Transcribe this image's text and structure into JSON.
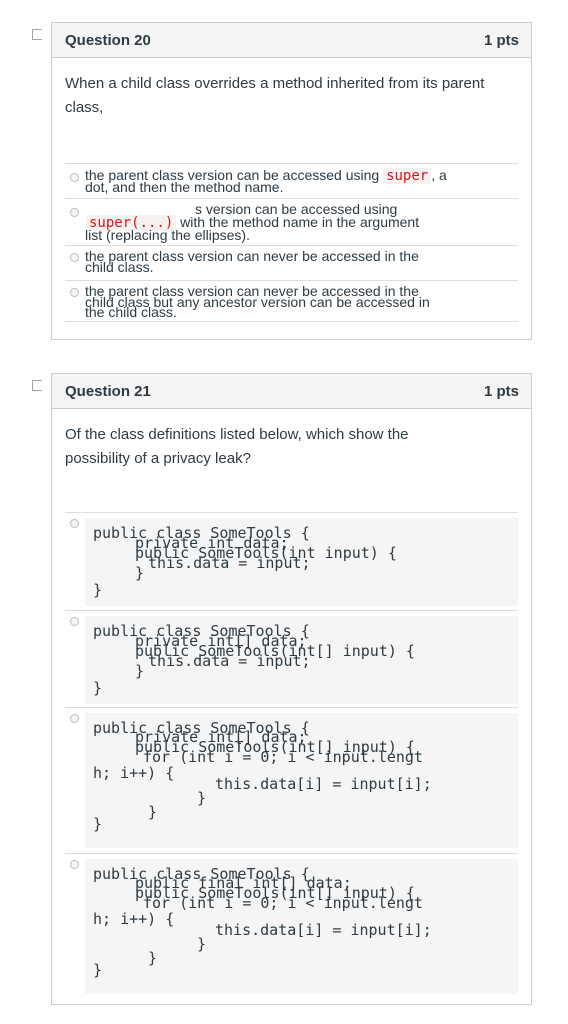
{
  "q20": {
    "title": "Question 20",
    "pts": "1 pts",
    "text": "When a child class overrides a method inherited from its parent class,",
    "answers": [
      {
        "l1a": "the parent class version can be accessed using ",
        "code": "super",
        "l1b": ", a",
        "l2": "dot, and then the method name."
      },
      {
        "l1": "s version can be accessed using",
        "code": "super(...)",
        "l2a": " with the method name in the argument",
        "l3": "list (replacing the ellipses)."
      },
      {
        "l1": "the parent class version can never be accessed in the",
        "l2": "child class."
      },
      {
        "l1": "the parent class version can never be accessed in the",
        "l2": "child class but any ancestor version can be accessed in",
        "l3": "the child class."
      }
    ]
  },
  "q21": {
    "title": "Question 21",
    "pts": "1 pts",
    "text": "Of the class definitions listed below, which show the possibility of a privacy leak?",
    "options": [
      {
        "lines": [
          "public class SomeTools {",
          "    private int data;",
          "    public SomeTools(int input) {",
          "        this.data = input;",
          "    }",
          "}"
        ]
      },
      {
        "lines": [
          "public class SomeTools {",
          "    private int[] data;",
          "    public SomeTools(int[] input) {",
          "        this.data = input;",
          "    }",
          "}"
        ]
      },
      {
        "lines": [
          "public class SomeTools {",
          "    private int[] data;",
          "    public SomeTools(int[] input) {",
          "        for (int i = 0; i < input.length; i++) {",
          "            this.data[i] = input[i];",
          "        }",
          "    }",
          "}"
        ]
      },
      {
        "lines": [
          "public class SomeTools {",
          "    public final int[] data;",
          "    public SomeTools(int[] input) {",
          "        for (int i = 0; i < input.length; i++) {",
          "            this.data[i] = input[i];",
          "        }",
          "    }",
          "}"
        ]
      }
    ]
  }
}
